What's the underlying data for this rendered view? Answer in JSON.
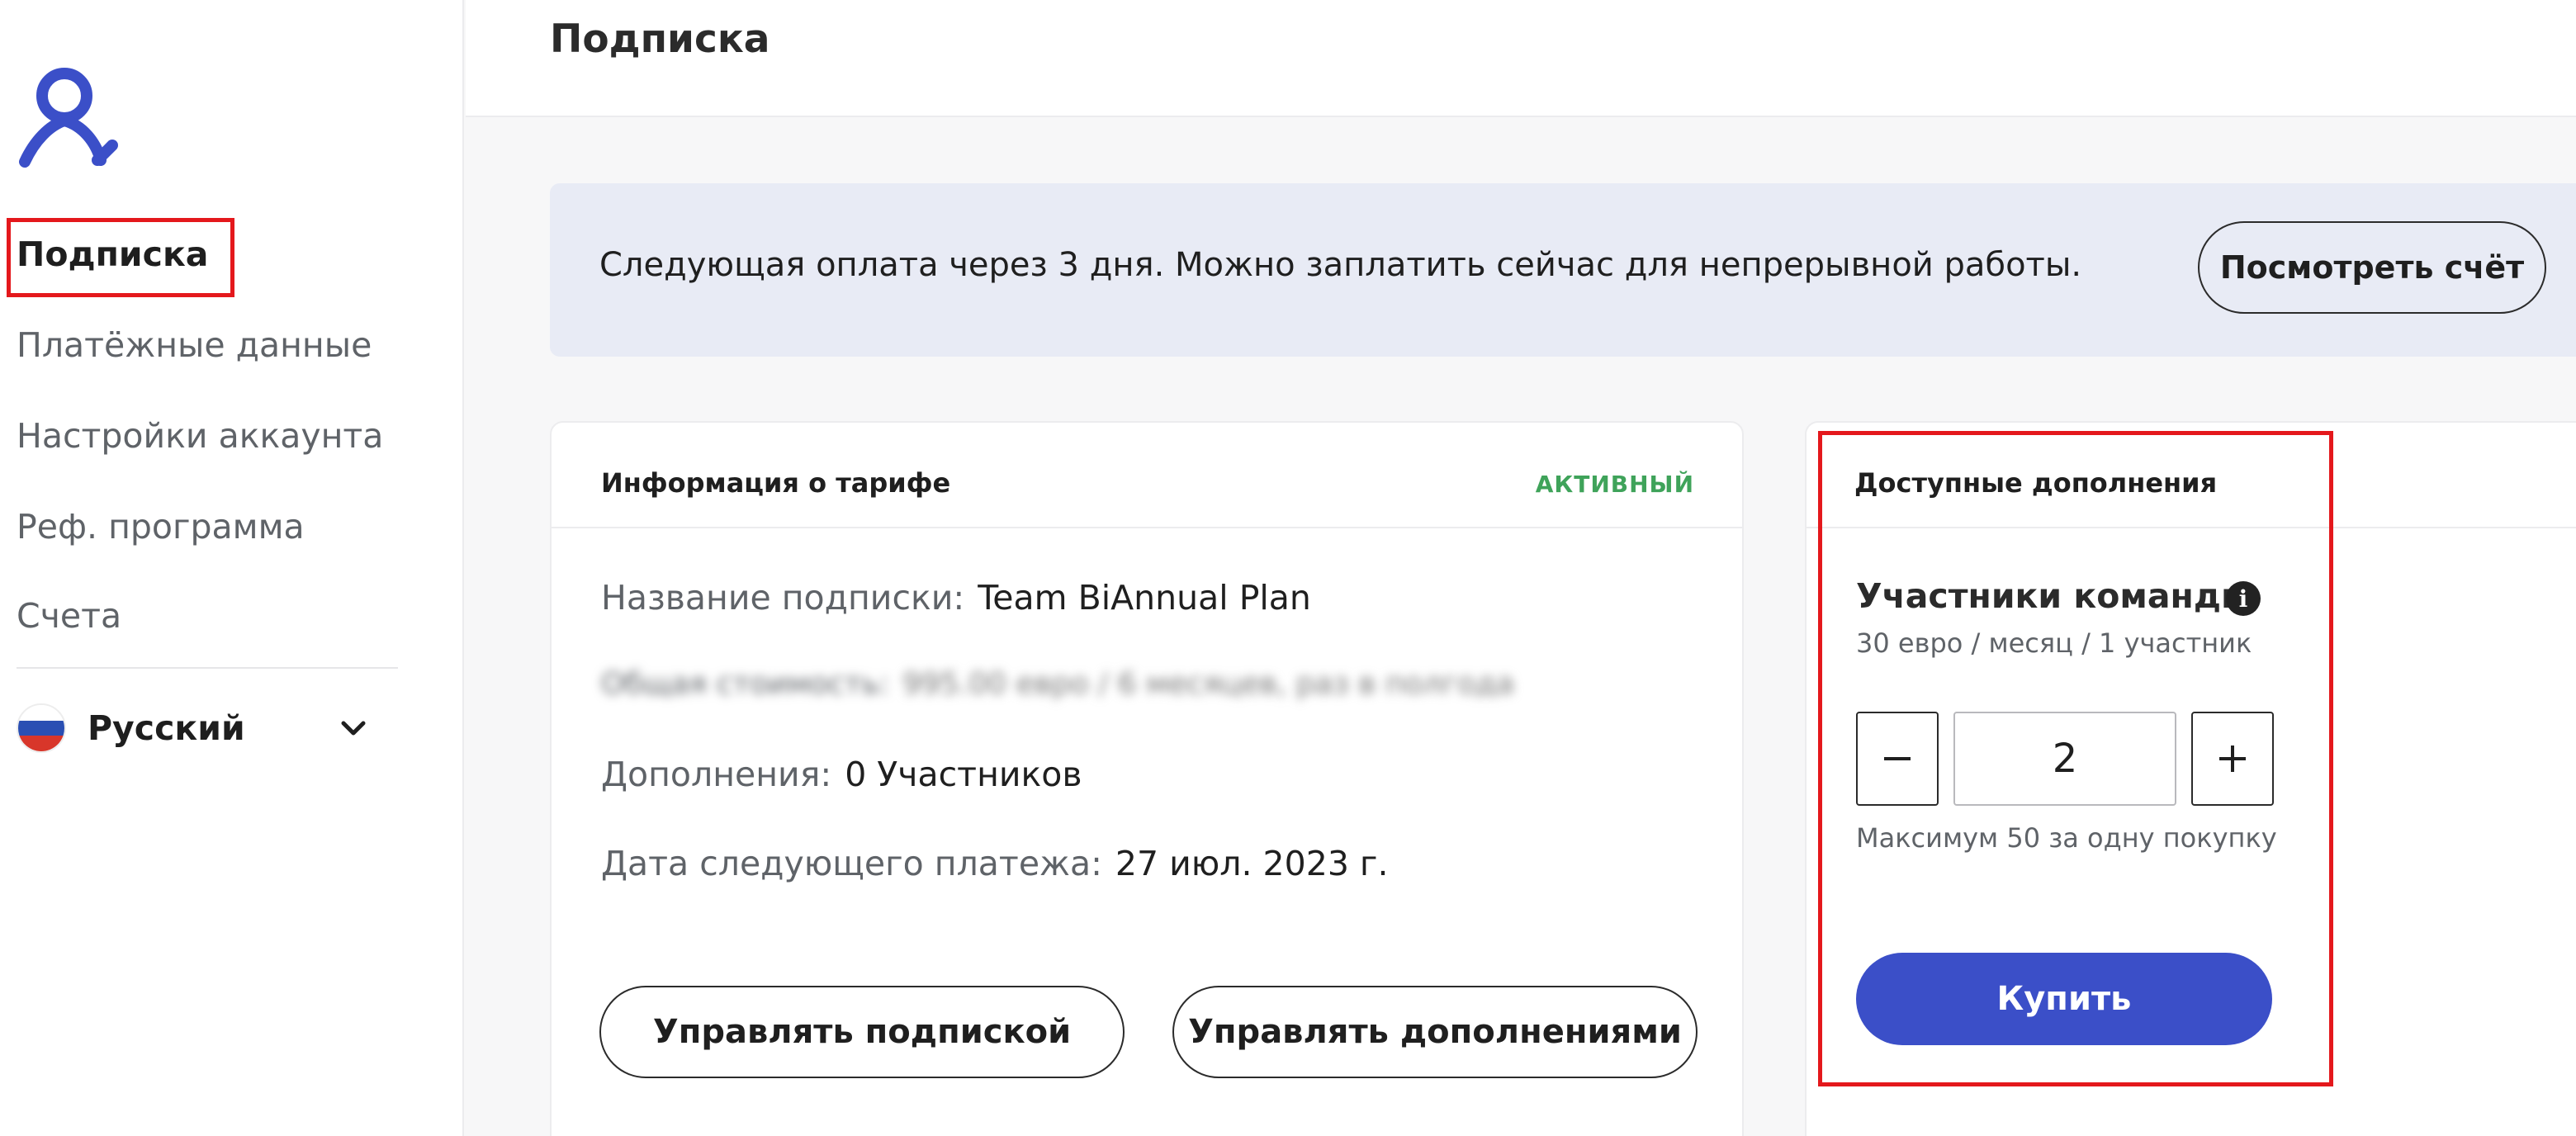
{
  "app": {
    "logo_icon": "person-logo-icon",
    "brand_color": "#3b4fc8"
  },
  "sidebar": {
    "items": [
      {
        "label": "Подписка",
        "active": true
      },
      {
        "label": "Платёжные данные",
        "active": false
      },
      {
        "label": "Настройки аккаунта",
        "active": false
      },
      {
        "label": "Реф. программа",
        "active": false
      },
      {
        "label": "Счета",
        "active": false
      }
    ],
    "language": {
      "label": "Русский",
      "flag_icon": "russia-flag-icon"
    }
  },
  "header": {
    "title": "Подписка"
  },
  "banner": {
    "text": "Следующая оплата через 3 дня. Можно заплатить сейчас для непрерывной работы.",
    "button_label": "Посмотреть счёт"
  },
  "plan": {
    "title": "Информация о тарифе",
    "status": "АКТИВНЫЙ",
    "status_color": "#3fa35a",
    "rows": [
      {
        "label": "Название подписки:",
        "value": "Team BiAnnual Plan"
      },
      {
        "label": "Общая стоимость:",
        "value": "995.00 евро / 6 месяцев, раз в полгода"
      },
      {
        "label": "Дополнения:",
        "value": "0 Участников"
      },
      {
        "label": "Дата следующего платежа:",
        "value": "27 июл. 2023 г."
      }
    ],
    "manage_subscription_label": "Управлять подпиской",
    "manage_addons_label": "Управлять дополнениями"
  },
  "addons": {
    "title": "Доступные дополнения",
    "item_name": "Участники команды",
    "item_price": "30 евро / месяц / 1 участник",
    "quantity": "2",
    "limit_text": "Максимум 50 за одну покупку",
    "buy_label": "Купить"
  },
  "annotations": {
    "highlight_color": "#e4181c"
  }
}
